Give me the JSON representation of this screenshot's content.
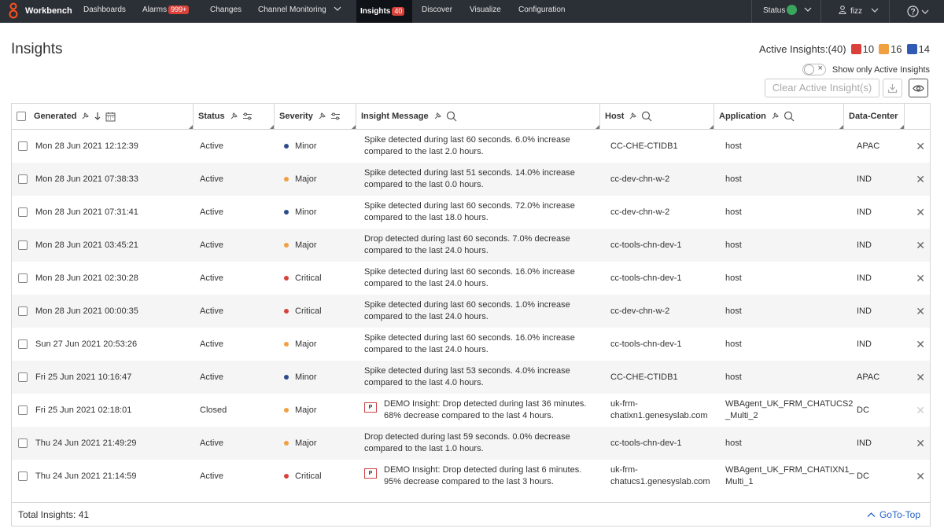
{
  "nav": {
    "brand": "Workbench",
    "items": [
      {
        "label": "Dashboards"
      },
      {
        "label": "Alarms",
        "badge": "999+"
      },
      {
        "label": "Changes"
      },
      {
        "label": "Channel Monitoring"
      },
      {
        "label": "Insights",
        "badge": "40"
      },
      {
        "label": "Discover"
      },
      {
        "label": "Visualize"
      },
      {
        "label": "Configuration"
      }
    ],
    "status_label": "Status",
    "user": "fizz"
  },
  "page": {
    "title": "Insights",
    "active_label": "Active Insights:(40)",
    "critical_count": "10",
    "major_count": "16",
    "minor_count": "14",
    "toggle_label": "Show only Active Insights",
    "clear_button": "Clear Active Insight(s)"
  },
  "colors": {
    "critical": "#d9413a",
    "major": "#f0a040",
    "minor": "#2f4a8a",
    "link": "#2563c6"
  },
  "table": {
    "columns": {
      "generated": "Generated",
      "status": "Status",
      "severity": "Severity",
      "message": "Insight Message",
      "host": "Host",
      "application": "Application",
      "datacenter": "Data-Center"
    },
    "rows": [
      {
        "generated": "Mon 28 Jun 2021 12:12:39",
        "status": "Active",
        "severity": "Minor",
        "msg1": "Spike detected during last 60 seconds. 6.0% increase",
        "msg2": "compared to the last 2.0 hours.",
        "host1": "CC-CHE-CTIDB1",
        "host2": "",
        "app1": "host",
        "app2": "",
        "dc": "APAC"
      },
      {
        "generated": "Mon 28 Jun 2021 07:38:33",
        "status": "Active",
        "severity": "Major",
        "msg1": "Spike detected during last 51 seconds. 14.0% increase",
        "msg2": "compared to the last 0.0 hours.",
        "host1": "cc-dev-chn-w-2",
        "host2": "",
        "app1": "host",
        "app2": "",
        "dc": "IND"
      },
      {
        "generated": "Mon 28 Jun 2021 07:31:41",
        "status": "Active",
        "severity": "Minor",
        "msg1": "Spike detected during last 60 seconds. 72.0% increase",
        "msg2": "compared to the last 18.0 hours.",
        "host1": "cc-dev-chn-w-2",
        "host2": "",
        "app1": "host",
        "app2": "",
        "dc": "IND"
      },
      {
        "generated": "Mon 28 Jun 2021 03:45:21",
        "status": "Active",
        "severity": "Major",
        "msg1": "Drop detected during last 60 seconds. 7.0% decrease",
        "msg2": "compared to the last 24.0 hours.",
        "host1": "cc-tools-chn-dev-1",
        "host2": "",
        "app1": "host",
        "app2": "",
        "dc": "IND"
      },
      {
        "generated": "Mon 28 Jun 2021 02:30:28",
        "status": "Active",
        "severity": "Critical",
        "msg1": "Spike detected during last 60 seconds. 16.0% increase",
        "msg2": "compared to the last 24.0 hours.",
        "host1": "cc-tools-chn-dev-1",
        "host2": "",
        "app1": "host",
        "app2": "",
        "dc": "IND"
      },
      {
        "generated": "Mon 28 Jun 2021 00:00:35",
        "status": "Active",
        "severity": "Critical",
        "msg1": "Spike detected during last 60 seconds. 1.0% increase",
        "msg2": "compared to the last 24.0 hours.",
        "host1": "cc-dev-chn-w-2",
        "host2": "",
        "app1": "host",
        "app2": "",
        "dc": "IND"
      },
      {
        "generated": "Sun 27 Jun 2021 20:53:26",
        "status": "Active",
        "severity": "Major",
        "msg1": "Spike detected during last 60 seconds. 16.0% increase",
        "msg2": "compared to the last 24.0 hours.",
        "host1": "cc-tools-chn-dev-1",
        "host2": "",
        "app1": "host",
        "app2": "",
        "dc": "IND"
      },
      {
        "generated": "Fri 25 Jun 2021 10:16:47",
        "status": "Active",
        "severity": "Minor",
        "msg1": "Spike detected during last 53 seconds. 4.0% increase",
        "msg2": "compared to the last 4.0 hours.",
        "host1": "CC-CHE-CTIDB1",
        "host2": "",
        "app1": "host",
        "app2": "",
        "dc": "APAC"
      },
      {
        "generated": "Fri 25 Jun 2021 02:18:01",
        "status": "Closed",
        "severity": "Major",
        "tag": "P",
        "msg1": "DEMO Insight: Drop detected during last 36 minutes.",
        "msg2": "68% decrease compared to the last 4 hours.",
        "host1": "uk-frm-",
        "host2": "chatixn1.genesyslab.com",
        "app1": "WBAgent_UK_FRM_CHATUCS2",
        "app2": "_Multi_2",
        "dc": "DC"
      },
      {
        "generated": "Thu 24 Jun 2021 21:49:29",
        "status": "Active",
        "severity": "Major",
        "msg1": "Drop detected during last 59 seconds. 0.0% decrease",
        "msg2": "compared to the last 1.0 hours.",
        "host1": "cc-tools-chn-dev-1",
        "host2": "",
        "app1": "host",
        "app2": "",
        "dc": "IND"
      },
      {
        "generated": "Thu 24 Jun 2021 21:14:59",
        "status": "Active",
        "severity": "Critical",
        "tag": "P",
        "msg1": "DEMO Insight: Drop detected during last 6 minutes.",
        "msg2": "95% decrease compared to the last 3 hours.",
        "host1": "uk-frm-",
        "host2": "chatucs1.genesyslab.com",
        "app1": "WBAgent_UK_FRM_CHATIXN1_",
        "app2": "Multi_1",
        "dc": "DC"
      }
    ]
  },
  "footer": {
    "total": "Total Insights: 41",
    "goto": "GoTo-Top"
  }
}
